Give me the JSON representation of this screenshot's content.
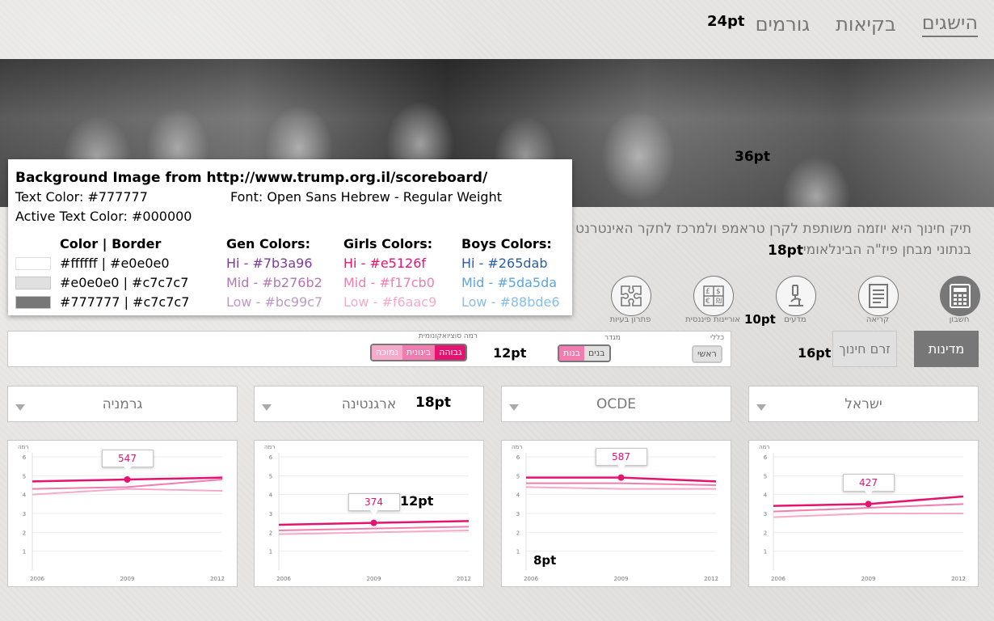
{
  "nav": {
    "items": [
      {
        "label": "הישגים",
        "active": true
      },
      {
        "label": "בקיאות",
        "active": false
      },
      {
        "label": "גורמים",
        "active": false
      }
    ]
  },
  "spec_annotations": {
    "nav": "24pt",
    "hero": "36pt",
    "intro": "18pt",
    "icons": "10pt",
    "filter_buttons": "16pt",
    "segments": "12pt",
    "dropdown": "18pt",
    "tooltip": "12pt",
    "axis": "8pt"
  },
  "spec_panel": {
    "line1": "Background Image from http://www.trump.org.il/scoreboard/",
    "line2": "Text Color: #777777",
    "line3": "Font: Open Sans Hebrew  - Regular Weight",
    "line4": "Active Text Color: #000000",
    "headers": {
      "color_border": "Color | Border",
      "gen": "Gen Colors:",
      "girls": "Girls Colors:",
      "boys": "Boys Colors:"
    },
    "swatches": [
      {
        "fill": "#ffffff",
        "border": "#e0e0e0",
        "label": "#ffffff | #e0e0e0"
      },
      {
        "fill": "#e0e0e0",
        "border": "#c7c7c7",
        "label": "#e0e0e0 | #c7c7c7"
      },
      {
        "fill": "#777777",
        "border": "#c7c7c7",
        "label": "#777777 | #c7c7c7"
      }
    ],
    "gen": [
      {
        "label": "Hi    - #7b3a96",
        "color": "#7b3a96"
      },
      {
        "label": "Mid - #b276b2",
        "color": "#b276b2"
      },
      {
        "label": "Low - #bc99c7",
        "color": "#bc99c7"
      }
    ],
    "girls": [
      {
        "label": "Hi    - #e5126f",
        "color": "#e5126f"
      },
      {
        "label": "Mid - #f17cb0",
        "color": "#f17cb0"
      },
      {
        "label": "Low - #f6aac9",
        "color": "#f6aac9"
      }
    ],
    "boys": [
      {
        "label": "Hi    - #265dab",
        "color": "#265dab"
      },
      {
        "label": "Mid - #5da5da",
        "color": "#5da5da"
      },
      {
        "label": "Low - #88bde6",
        "color": "#88bde6"
      }
    ]
  },
  "intro": {
    "line1": "תיק חינוך היא יוזמה משותפת לקרן טראמפ ולמרכז לחקר האינטרנט באו",
    "line2": "בנתוני מבחן פיז\"ה הבינלאומי."
  },
  "subjects": [
    {
      "label": "חשבון",
      "icon": "calculator-icon",
      "active": true
    },
    {
      "label": "קריאה",
      "icon": "document-icon",
      "active": false
    },
    {
      "label": "מדעים",
      "icon": "microscope-icon",
      "active": false
    },
    {
      "label": "אוריינות פיננסית",
      "icon": "currency-icon",
      "active": false
    },
    {
      "label": "פתרון בעיות",
      "icon": "puzzle-icon",
      "active": false
    }
  ],
  "filters": {
    "countries_btn": "מדינות",
    "stream_btn": "זרם חינוך",
    "general_label": "כללי",
    "general_value": "ראשי",
    "gender_label": "מגדר",
    "gender_options": [
      "בנים",
      "בנות"
    ],
    "ses_label": "רמה סוציואקונומית",
    "ses_options": [
      "גבוהה",
      "בינונית",
      "נמוכה"
    ]
  },
  "dropdowns": [
    "ישראל",
    "OCDE",
    "ארגנטינה",
    "גרמניה"
  ],
  "colors": {
    "girls_hi": "#e5126f",
    "girls_mid": "#f17cb0",
    "girls_low": "#f6aac9",
    "text": "#777777"
  },
  "chart_data": [
    {
      "type": "line",
      "country": "ישראל",
      "ylabel": "רמה",
      "x": [
        2006,
        2009,
        2012
      ],
      "ylim": [
        0,
        6
      ],
      "yticks": [
        1,
        2,
        3,
        4,
        5,
        6
      ],
      "series": [
        {
          "values": [
            3.4,
            3.5,
            3.9
          ],
          "color": "#e5126f"
        },
        {
          "values": [
            3.1,
            3.3,
            3.5
          ],
          "color": "#f17cb0"
        },
        {
          "values": [
            2.8,
            3.0,
            3.0
          ],
          "color": "#f6aac9"
        }
      ],
      "tooltip": "427"
    },
    {
      "type": "line",
      "country": "OCDE",
      "ylabel": "רמה",
      "x": [
        2006,
        2009,
        2012
      ],
      "ylim": [
        0,
        6
      ],
      "yticks": [
        1,
        2,
        3,
        4,
        5,
        6
      ],
      "series": [
        {
          "values": [
            4.9,
            4.9,
            4.7
          ],
          "color": "#e5126f"
        },
        {
          "values": [
            4.6,
            4.6,
            4.5
          ],
          "color": "#f17cb0"
        },
        {
          "values": [
            4.4,
            4.3,
            4.3
          ],
          "color": "#f6aac9"
        }
      ],
      "tooltip": "587"
    },
    {
      "type": "line",
      "country": "ארגנטינה",
      "ylabel": "רמה",
      "x": [
        2006,
        2009,
        2012
      ],
      "ylim": [
        0,
        6
      ],
      "yticks": [
        1,
        2,
        3,
        4,
        5,
        6
      ],
      "series": [
        {
          "values": [
            2.4,
            2.5,
            2.6
          ],
          "color": "#e5126f"
        },
        {
          "values": [
            2.1,
            2.2,
            2.3
          ],
          "color": "#f17cb0"
        },
        {
          "values": [
            1.9,
            2.0,
            2.1
          ],
          "color": "#f6aac9"
        }
      ],
      "tooltip": "374"
    },
    {
      "type": "line",
      "country": "גרמניה",
      "ylabel": "רמה",
      "x": [
        2006,
        2009,
        2012
      ],
      "ylim": [
        0,
        6
      ],
      "yticks": [
        1,
        2,
        3,
        4,
        5,
        6
      ],
      "series": [
        {
          "values": [
            4.7,
            4.8,
            4.9
          ],
          "color": "#e5126f"
        },
        {
          "values": [
            4.3,
            4.4,
            4.8
          ],
          "color": "#f17cb0"
        },
        {
          "values": [
            4.0,
            4.3,
            4.2
          ],
          "color": "#f6aac9"
        }
      ],
      "tooltip": "547"
    }
  ]
}
